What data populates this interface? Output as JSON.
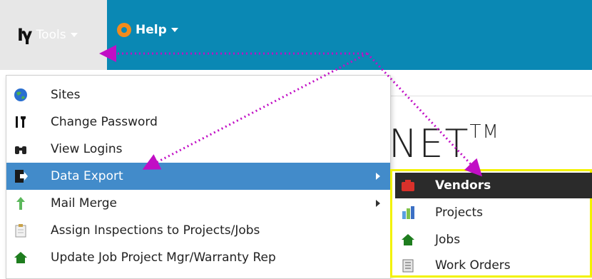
{
  "topbar": {
    "tools_label": "Tools",
    "help_label": "Help",
    "tools_icon": "tools-icon",
    "help_icon": "lifebuoy-icon",
    "bar_color": "#0a88b4"
  },
  "background": {
    "title_fragment": "NET",
    "trademark": "TM"
  },
  "tools_menu": {
    "items": [
      {
        "label": "Sites",
        "icon": "globe-icon"
      },
      {
        "label": "Change Password",
        "icon": "tools-icon"
      },
      {
        "label": "View Logins",
        "icon": "binoculars-icon"
      },
      {
        "label": "Data Export",
        "icon": "export-icon",
        "active": true,
        "has_submenu": true
      },
      {
        "label": "Mail Merge",
        "icon": "mail-merge-icon",
        "has_submenu": true
      },
      {
        "label": "Assign Inspections to Projects/Jobs",
        "icon": "clipboard-icon"
      },
      {
        "label": "Update Job Project Mgr/Warranty Rep",
        "icon": "house-icon"
      }
    ],
    "active_color": "#428bca"
  },
  "export_submenu": {
    "items": [
      {
        "label": "Vendors",
        "icon": "vendors-icon",
        "active": true
      },
      {
        "label": "Projects",
        "icon": "projects-icon"
      },
      {
        "label": "Jobs",
        "icon": "house-icon"
      },
      {
        "label": "Work Orders",
        "icon": "work-orders-icon"
      }
    ],
    "highlight_color": "#f2f200"
  }
}
